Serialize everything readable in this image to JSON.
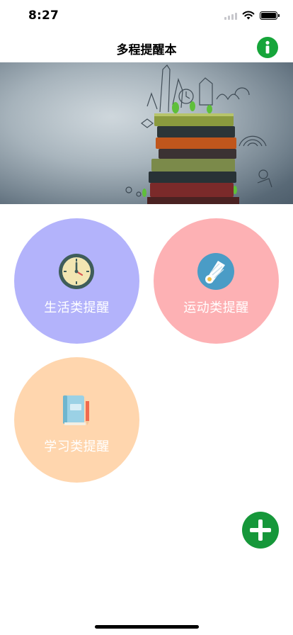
{
  "status_bar": {
    "time": "8:27",
    "icons": [
      "signal-icon",
      "wifi-icon",
      "battery-icon"
    ]
  },
  "nav": {
    "title": "多程提醒本",
    "info_icon": "info-icon",
    "info_color": "#16a53a"
  },
  "banner": {
    "image": "stack-of-books-with-doodles"
  },
  "categories": [
    {
      "label": "生活类提醒",
      "icon": "clock-icon",
      "color": "#b3b3fb"
    },
    {
      "label": "运动类提醒",
      "icon": "shuttlecock-icon",
      "color": "#fdb1b4"
    },
    {
      "label": "学习类提醒",
      "icon": "book-pencil-icon",
      "color": "#ffd6ae"
    }
  ],
  "add_button": {
    "icon": "plus-icon",
    "color": "#16973a"
  }
}
